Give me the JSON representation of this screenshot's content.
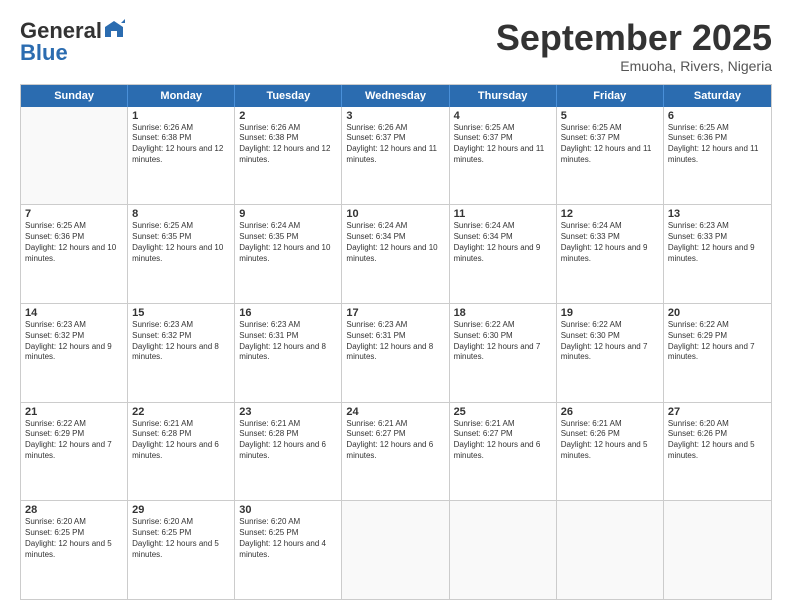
{
  "logo": {
    "general": "General",
    "blue": "Blue"
  },
  "title": "September 2025",
  "subtitle": "Emuoha, Rivers, Nigeria",
  "days": [
    "Sunday",
    "Monday",
    "Tuesday",
    "Wednesday",
    "Thursday",
    "Friday",
    "Saturday"
  ],
  "rows": [
    [
      {
        "day": "",
        "empty": true
      },
      {
        "day": "1",
        "sunrise": "6:26 AM",
        "sunset": "6:38 PM",
        "daylight": "12 hours and 12 minutes."
      },
      {
        "day": "2",
        "sunrise": "6:26 AM",
        "sunset": "6:38 PM",
        "daylight": "12 hours and 12 minutes."
      },
      {
        "day": "3",
        "sunrise": "6:26 AM",
        "sunset": "6:37 PM",
        "daylight": "12 hours and 11 minutes."
      },
      {
        "day": "4",
        "sunrise": "6:25 AM",
        "sunset": "6:37 PM",
        "daylight": "12 hours and 11 minutes."
      },
      {
        "day": "5",
        "sunrise": "6:25 AM",
        "sunset": "6:37 PM",
        "daylight": "12 hours and 11 minutes."
      },
      {
        "day": "6",
        "sunrise": "6:25 AM",
        "sunset": "6:36 PM",
        "daylight": "12 hours and 11 minutes."
      }
    ],
    [
      {
        "day": "7",
        "sunrise": "6:25 AM",
        "sunset": "6:36 PM",
        "daylight": "12 hours and 10 minutes."
      },
      {
        "day": "8",
        "sunrise": "6:25 AM",
        "sunset": "6:35 PM",
        "daylight": "12 hours and 10 minutes."
      },
      {
        "day": "9",
        "sunrise": "6:24 AM",
        "sunset": "6:35 PM",
        "daylight": "12 hours and 10 minutes."
      },
      {
        "day": "10",
        "sunrise": "6:24 AM",
        "sunset": "6:34 PM",
        "daylight": "12 hours and 10 minutes."
      },
      {
        "day": "11",
        "sunrise": "6:24 AM",
        "sunset": "6:34 PM",
        "daylight": "12 hours and 9 minutes."
      },
      {
        "day": "12",
        "sunrise": "6:24 AM",
        "sunset": "6:33 PM",
        "daylight": "12 hours and 9 minutes."
      },
      {
        "day": "13",
        "sunrise": "6:23 AM",
        "sunset": "6:33 PM",
        "daylight": "12 hours and 9 minutes."
      }
    ],
    [
      {
        "day": "14",
        "sunrise": "6:23 AM",
        "sunset": "6:32 PM",
        "daylight": "12 hours and 9 minutes."
      },
      {
        "day": "15",
        "sunrise": "6:23 AM",
        "sunset": "6:32 PM",
        "daylight": "12 hours and 8 minutes."
      },
      {
        "day": "16",
        "sunrise": "6:23 AM",
        "sunset": "6:31 PM",
        "daylight": "12 hours and 8 minutes."
      },
      {
        "day": "17",
        "sunrise": "6:23 AM",
        "sunset": "6:31 PM",
        "daylight": "12 hours and 8 minutes."
      },
      {
        "day": "18",
        "sunrise": "6:22 AM",
        "sunset": "6:30 PM",
        "daylight": "12 hours and 7 minutes."
      },
      {
        "day": "19",
        "sunrise": "6:22 AM",
        "sunset": "6:30 PM",
        "daylight": "12 hours and 7 minutes."
      },
      {
        "day": "20",
        "sunrise": "6:22 AM",
        "sunset": "6:29 PM",
        "daylight": "12 hours and 7 minutes."
      }
    ],
    [
      {
        "day": "21",
        "sunrise": "6:22 AM",
        "sunset": "6:29 PM",
        "daylight": "12 hours and 7 minutes."
      },
      {
        "day": "22",
        "sunrise": "6:21 AM",
        "sunset": "6:28 PM",
        "daylight": "12 hours and 6 minutes."
      },
      {
        "day": "23",
        "sunrise": "6:21 AM",
        "sunset": "6:28 PM",
        "daylight": "12 hours and 6 minutes."
      },
      {
        "day": "24",
        "sunrise": "6:21 AM",
        "sunset": "6:27 PM",
        "daylight": "12 hours and 6 minutes."
      },
      {
        "day": "25",
        "sunrise": "6:21 AM",
        "sunset": "6:27 PM",
        "daylight": "12 hours and 6 minutes."
      },
      {
        "day": "26",
        "sunrise": "6:21 AM",
        "sunset": "6:26 PM",
        "daylight": "12 hours and 5 minutes."
      },
      {
        "day": "27",
        "sunrise": "6:20 AM",
        "sunset": "6:26 PM",
        "daylight": "12 hours and 5 minutes."
      }
    ],
    [
      {
        "day": "28",
        "sunrise": "6:20 AM",
        "sunset": "6:25 PM",
        "daylight": "12 hours and 5 minutes."
      },
      {
        "day": "29",
        "sunrise": "6:20 AM",
        "sunset": "6:25 PM",
        "daylight": "12 hours and 5 minutes."
      },
      {
        "day": "30",
        "sunrise": "6:20 AM",
        "sunset": "6:25 PM",
        "daylight": "12 hours and 4 minutes."
      },
      {
        "day": "",
        "empty": true
      },
      {
        "day": "",
        "empty": true
      },
      {
        "day": "",
        "empty": true
      },
      {
        "day": "",
        "empty": true
      }
    ]
  ]
}
